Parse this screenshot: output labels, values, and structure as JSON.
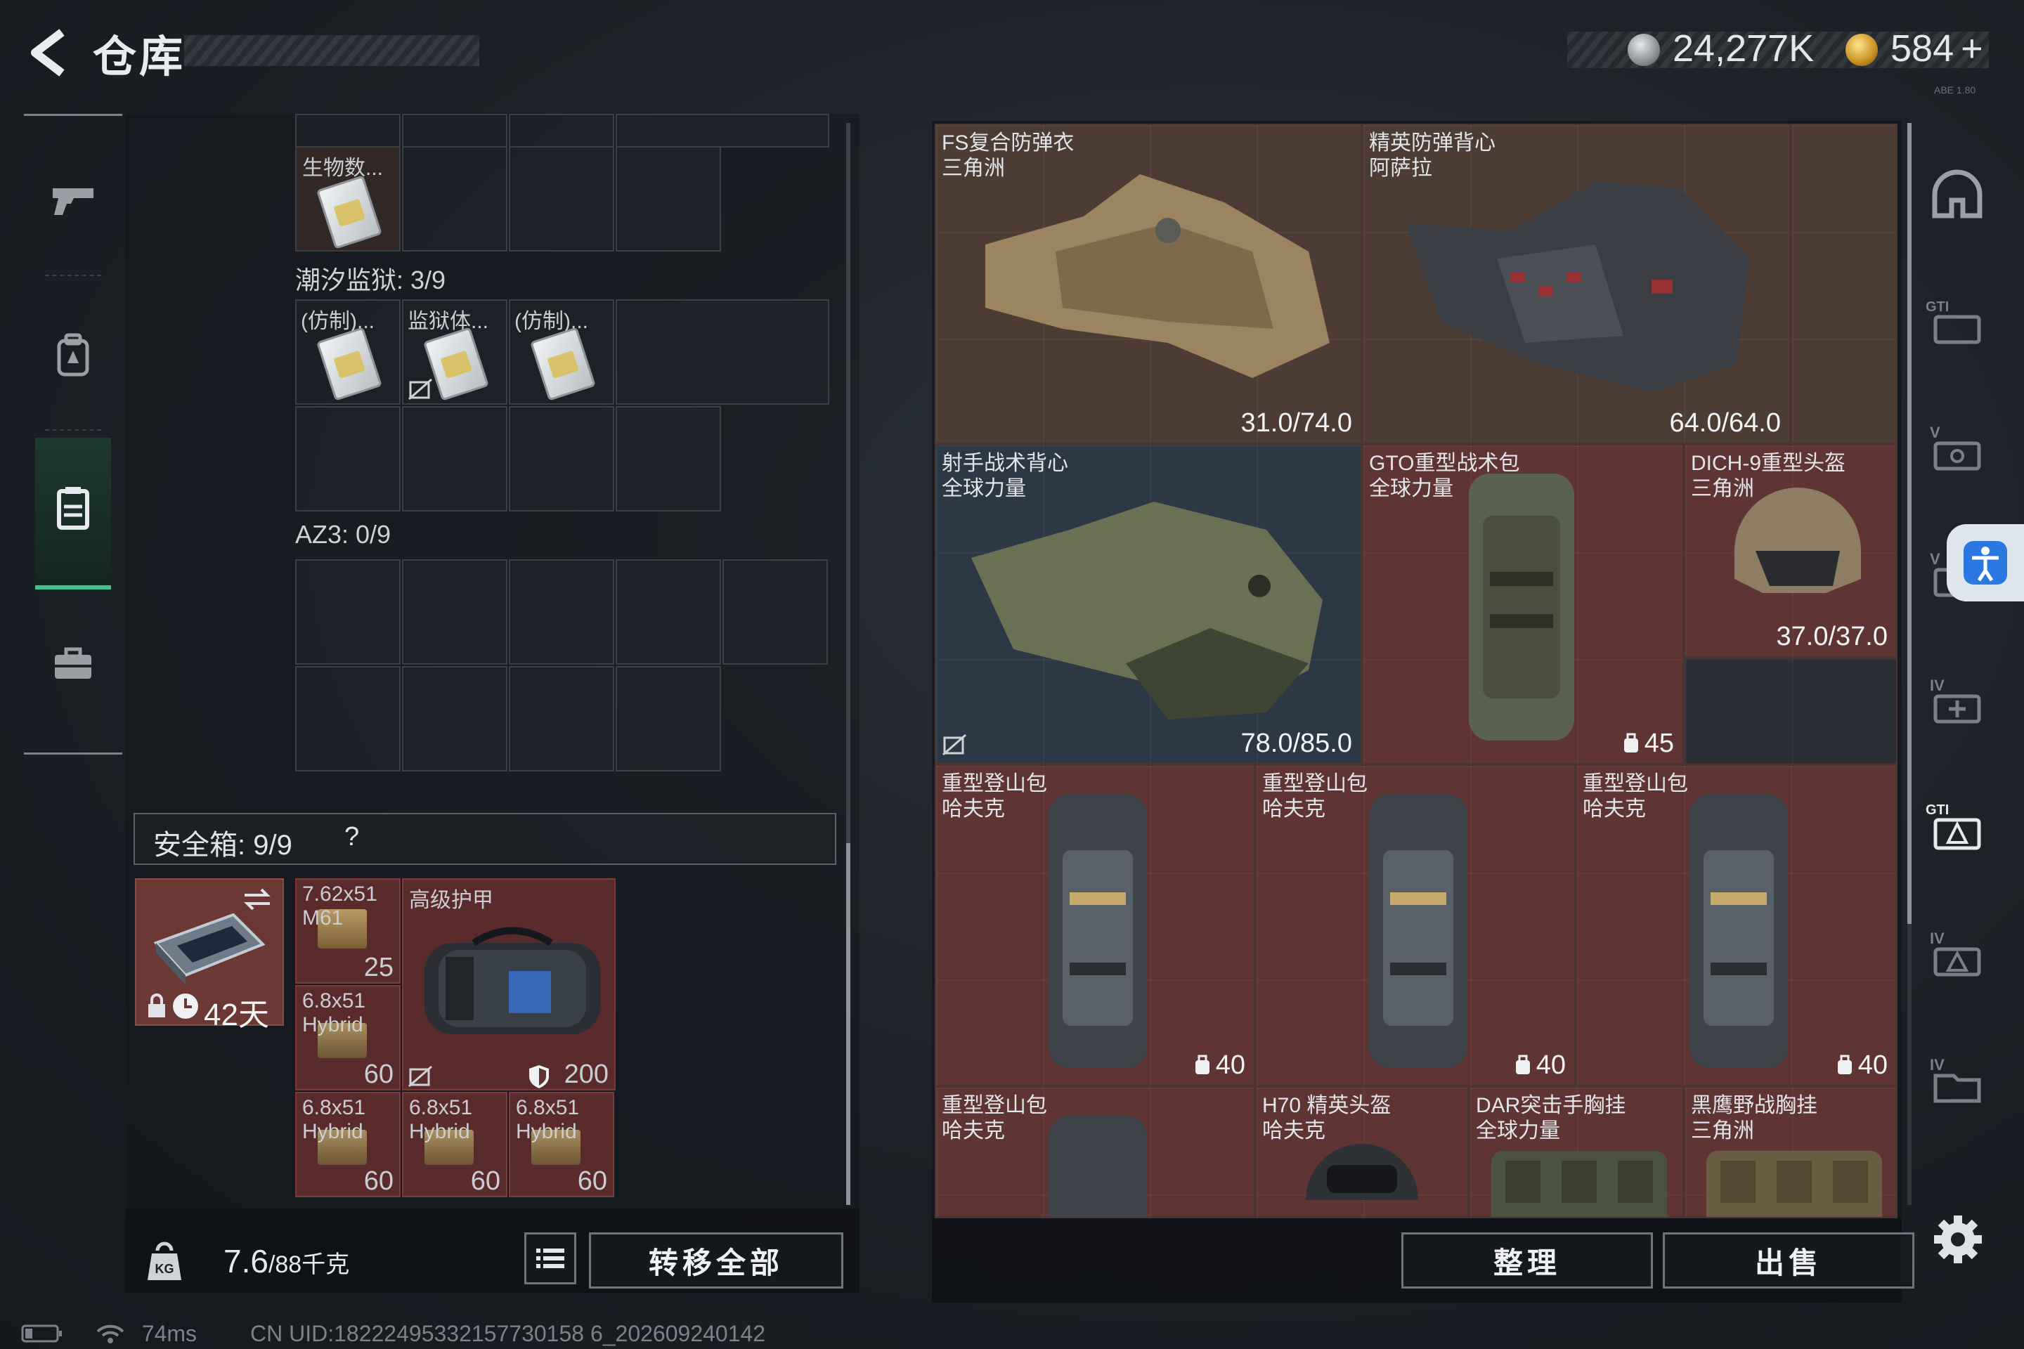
{
  "header": {
    "title": "仓库"
  },
  "currency": {
    "coins": "24,277K",
    "premium": "584",
    "add_symbol": "+"
  },
  "version": "ABE 1.80",
  "sidebar": {
    "items": [
      {
        "label": "weapons",
        "icon": "pistol-icon"
      },
      {
        "label": "equipment",
        "icon": "backpack-icon"
      },
      {
        "label": "storage",
        "icon": "locker-icon",
        "active": true
      },
      {
        "label": "briefcase",
        "icon": "briefcase-icon"
      }
    ]
  },
  "left_panel": {
    "top_item_label": "生物数...",
    "section_tide": "潮汐监狱: 3/9",
    "tide_items": [
      "(仿制)...",
      "监狱体...",
      "(仿制)..."
    ],
    "section_az3": "AZ3: 0/9",
    "safebox_label": "安全箱: 9/9",
    "safebox_help": "?",
    "safebox_time": "42天",
    "safe_items": [
      {
        "name": "7.62x51\nM61",
        "count": "25"
      },
      {
        "name": "高级护甲",
        "count": "200"
      },
      {
        "name": "6.8x51\nHybrid",
        "count": "60"
      },
      {
        "name": "6.8x51\nHybrid",
        "count": "60"
      },
      {
        "name": "6.8x51\nHybrid",
        "count": "60"
      },
      {
        "name": "6.8x51\nHybrid",
        "count": "60"
      }
    ]
  },
  "bottom_left": {
    "weight": "7.6",
    "weight_max": "/88千克",
    "transfer_all": "转移全部"
  },
  "right_panel": {
    "items": [
      {
        "name": "FS复合防弹衣",
        "sub": "三角洲",
        "value": "31.0/74.0"
      },
      {
        "name": "精英防弹背心",
        "sub": "阿萨拉",
        "value": "64.0/64.0"
      },
      {
        "name": "射手战术背心",
        "sub": "全球力量",
        "value": "78.0/85.0"
      },
      {
        "name": "GTO重型战术包",
        "sub": "全球力量",
        "value": "45"
      },
      {
        "name": "DICH-9重型头盔",
        "sub": "三角洲",
        "value": "37.0/37.0"
      },
      {
        "name": "重型登山包",
        "sub": "哈夫克",
        "value": "40"
      },
      {
        "name": "重型登山包",
        "sub": "哈夫克",
        "value": "40"
      },
      {
        "name": "重型登山包",
        "sub": "哈夫克",
        "value": "40"
      },
      {
        "name": "重型登山包",
        "sub": "哈夫克",
        "value": ""
      },
      {
        "name": "H70 精英头盔",
        "sub": "哈夫克",
        "value": ""
      },
      {
        "name": "DAR突击手胸挂",
        "sub": "全球力量",
        "value": ""
      },
      {
        "name": "黑鹰野战胸挂",
        "sub": "三角洲",
        "value": ""
      }
    ],
    "sort_button": "整理",
    "sell_button": "出售"
  },
  "right_sidebar": [
    "helmet-tier-icon",
    "GTI",
    "V",
    "V",
    "IV",
    "GTI",
    "IV",
    "IV"
  ],
  "status": {
    "ping": "74ms",
    "uid": "CN UID:18222495332157730158 6_202609240142"
  }
}
